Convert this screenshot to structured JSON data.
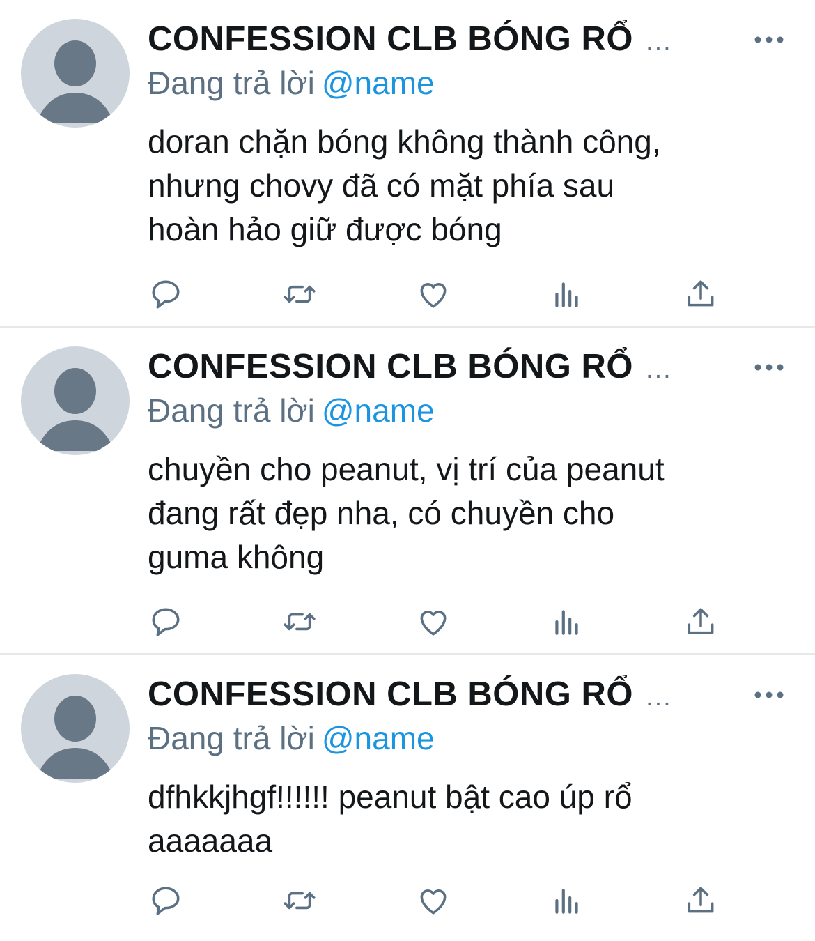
{
  "colors": {
    "text": "#14171a",
    "secondary": "#5b7083",
    "link": "#1b95e0",
    "divider": "#e6e8ea",
    "avatar_bg": "#ced5dd",
    "avatar_fg": "#697886"
  },
  "icons": {
    "more": "ellipsis-horizontal-icon",
    "reply": "speech-bubble-icon",
    "retweet": "retweet-arrows-icon",
    "like": "heart-icon",
    "analytics": "bar-chart-icon",
    "share": "share-upload-icon"
  },
  "tweets": [
    {
      "display_name": "CONFESSION CLB BÓNG RỔ",
      "truncation": "...",
      "reply_prefix": "Đang trả lời",
      "reply_handle": "@name",
      "lines": [
        "doran chặn bóng không thành công,",
        "nhưng chovy đã có mặt phía sau",
        "hoàn hảo giữ được bóng"
      ]
    },
    {
      "display_name": "CONFESSION CLB BÓNG RỔ",
      "truncation": "...",
      "reply_prefix": "Đang trả lời",
      "reply_handle": "@name",
      "lines": [
        "chuyền cho peanut, vị trí của peanut",
        "đang rất đẹp nha, có chuyền cho",
        "guma không"
      ]
    },
    {
      "display_name": "CONFESSION CLB BÓNG RỔ",
      "truncation": "...",
      "reply_prefix": "Đang trả lời",
      "reply_handle": "@name",
      "lines": [
        "dfhkkjhgf!!!!!! peanut bật cao úp rổ",
        "aaaaaaa"
      ]
    }
  ]
}
